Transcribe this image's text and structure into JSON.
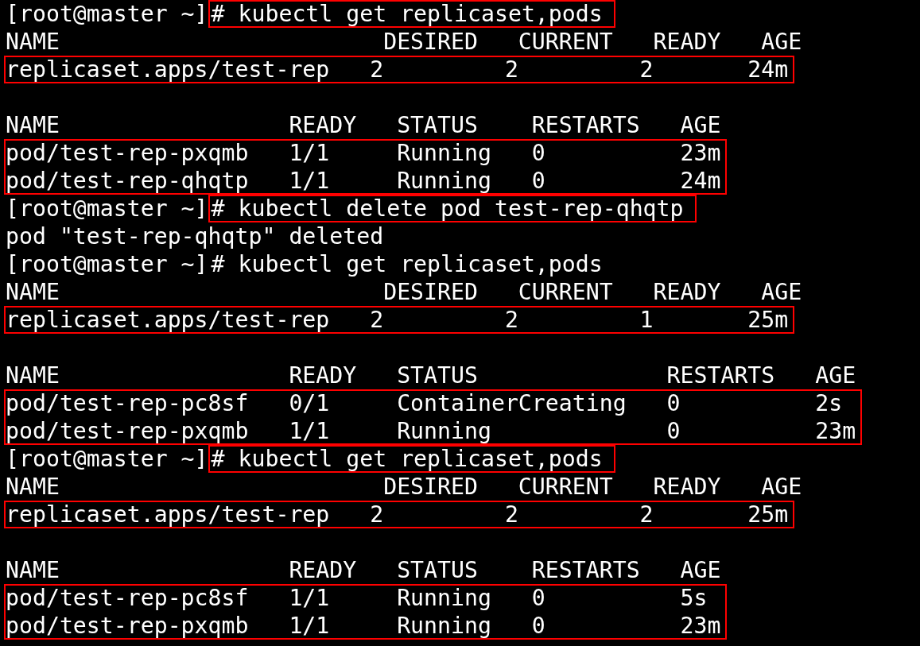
{
  "terminal": {
    "blocks": [
      {
        "kind": "prompt",
        "prompt": "[root@master ~]",
        "command": "# kubectl get replicaset,pods",
        "highlighted": true
      },
      {
        "kind": "lines",
        "highlighted": false,
        "lines": [
          "NAME                        DESIRED   CURRENT   READY   AGE"
        ]
      },
      {
        "kind": "lines",
        "highlighted": true,
        "lines": [
          "replicaset.apps/test-rep   2         2         2       24m"
        ]
      },
      {
        "kind": "blank"
      },
      {
        "kind": "lines",
        "highlighted": false,
        "lines": [
          "NAME                 READY   STATUS    RESTARTS   AGE"
        ]
      },
      {
        "kind": "lines",
        "highlighted": true,
        "lines": [
          "pod/test-rep-pxqmb   1/1     Running   0          23m",
          "pod/test-rep-qhqtp   1/1     Running   0          24m"
        ]
      },
      {
        "kind": "prompt",
        "prompt": "[root@master ~]",
        "command": "# kubectl delete pod test-rep-qhqtp",
        "highlighted": true
      },
      {
        "kind": "lines",
        "highlighted": false,
        "lines": [
          "pod \"test-rep-qhqtp\" deleted"
        ]
      },
      {
        "kind": "prompt",
        "prompt": "[root@master ~]",
        "command": "# kubectl get replicaset,pods",
        "highlighted": false
      },
      {
        "kind": "lines",
        "highlighted": false,
        "lines": [
          "NAME                        DESIRED   CURRENT   READY   AGE"
        ]
      },
      {
        "kind": "lines",
        "highlighted": true,
        "lines": [
          "replicaset.apps/test-rep   2         2         1       25m"
        ]
      },
      {
        "kind": "blank"
      },
      {
        "kind": "lines",
        "highlighted": false,
        "lines": [
          "NAME                 READY   STATUS              RESTARTS   AGE"
        ]
      },
      {
        "kind": "lines",
        "highlighted": true,
        "lines": [
          "pod/test-rep-pc8sf   0/1     ContainerCreating   0          2s",
          "pod/test-rep-pxqmb   1/1     Running             0          23m"
        ]
      },
      {
        "kind": "prompt",
        "prompt": "[root@master ~]",
        "command": "# kubectl get replicaset,pods",
        "highlighted": true
      },
      {
        "kind": "lines",
        "highlighted": false,
        "lines": [
          "NAME                        DESIRED   CURRENT   READY   AGE"
        ]
      },
      {
        "kind": "lines",
        "highlighted": true,
        "lines": [
          "replicaset.apps/test-rep   2         2         2       25m"
        ]
      },
      {
        "kind": "blank"
      },
      {
        "kind": "lines",
        "highlighted": false,
        "lines": [
          "NAME                 READY   STATUS    RESTARTS   AGE"
        ]
      },
      {
        "kind": "lines",
        "highlighted": true,
        "lines": [
          "pod/test-rep-pc8sf   1/1     Running   0          5s",
          "pod/test-rep-pxqmb   1/1     Running   0          23m"
        ]
      }
    ]
  }
}
